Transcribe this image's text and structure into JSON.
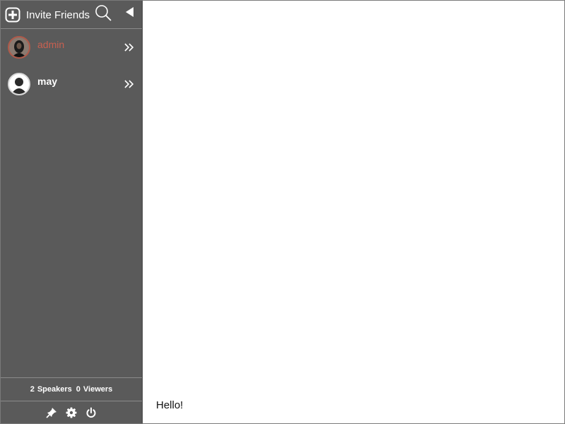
{
  "header": {
    "invite_label": "Invite Friends",
    "plus_icon": "plus-circle-icon",
    "search_icon": "search-icon",
    "collapse_icon": "triangle-left-icon"
  },
  "users": [
    {
      "name": "admin",
      "avatar": "photo-avatar",
      "name_color": "#c86050",
      "chevron": "double-chevron-right-icon"
    },
    {
      "name": "may",
      "avatar": "default-person-avatar",
      "name_color": "#ffffff",
      "chevron": "double-chevron-right-icon"
    }
  ],
  "stats": {
    "speakers_count": "2",
    "speakers_label": "Speakers",
    "viewers_count": "0",
    "viewers_label": "Viewers"
  },
  "footer": {
    "icons": [
      "pin-icon",
      "gear-icon",
      "power-icon"
    ]
  },
  "main": {
    "message": "Hello!"
  },
  "colors": {
    "sidebar_bg": "#5a5a5a",
    "accent_admin": "#c86050",
    "main_bg": "#ffffff"
  }
}
